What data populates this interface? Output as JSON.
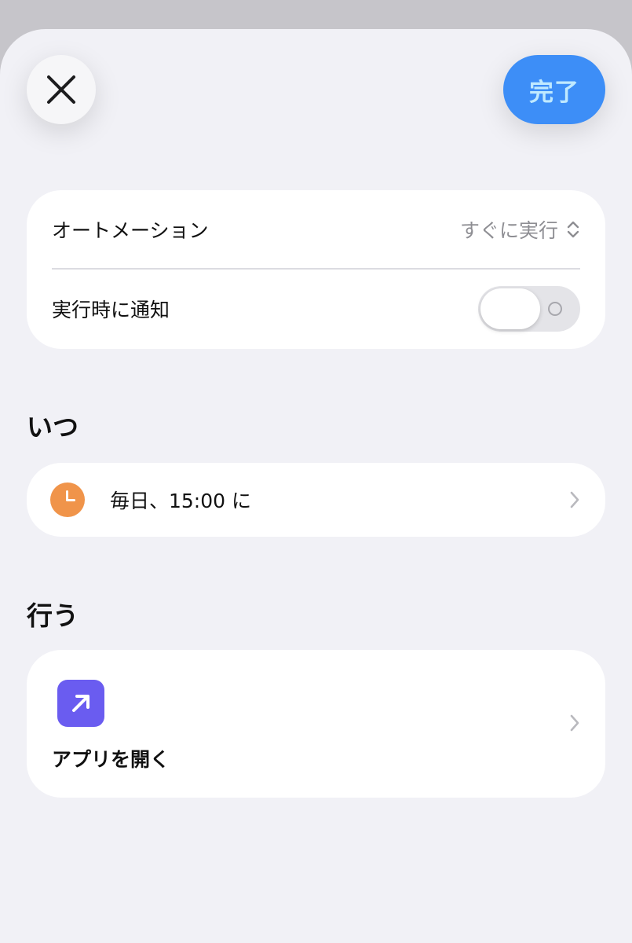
{
  "header": {
    "close_icon": "close-icon",
    "done_label": "完了"
  },
  "settings": {
    "automation_label": "オートメーション",
    "automation_value": "すぐに実行",
    "notify_label": "実行時に通知",
    "notify_enabled": false
  },
  "when": {
    "section_title": "いつ",
    "schedule_text": "毎日、15:00 に",
    "icon": "clock-icon"
  },
  "do": {
    "section_title": "行う",
    "action_label": "アプリを開く",
    "icon": "open-app-arrow-icon"
  },
  "colors": {
    "accent": "#3d8ef7",
    "clock": "#f0944a",
    "app_icon": "#6a5cf0"
  }
}
